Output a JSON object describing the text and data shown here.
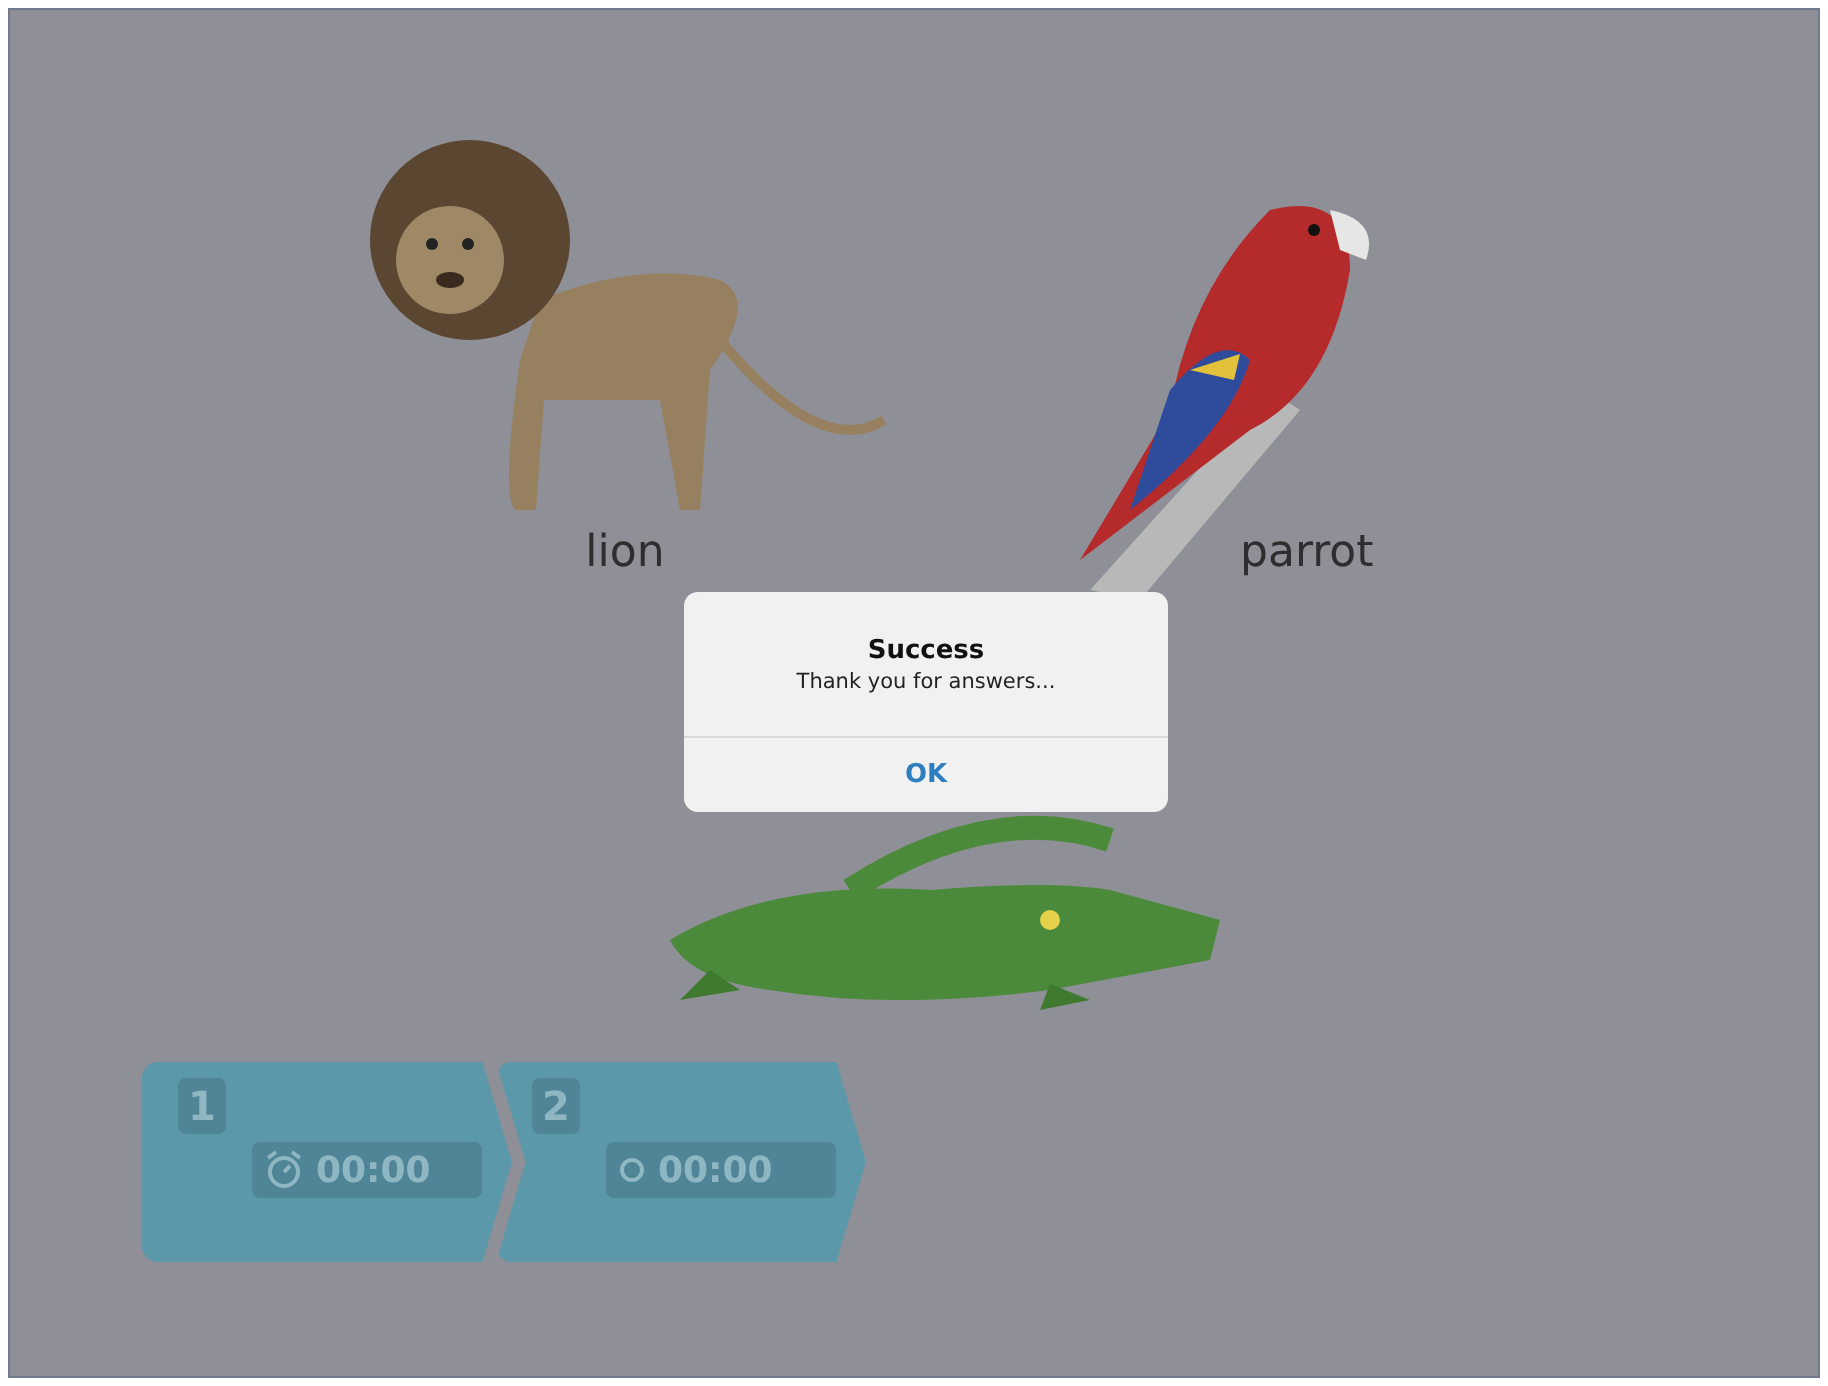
{
  "animals": [
    {
      "kind": "lion",
      "label": "lion"
    },
    {
      "kind": "parrot",
      "label": "parrot"
    },
    {
      "kind": "crocodile"
    }
  ],
  "steps": [
    {
      "number": "1",
      "timer": "00:00",
      "kind": "alarm"
    },
    {
      "number": "2",
      "timer": "00:00",
      "kind": "stopwatch"
    }
  ],
  "dialog": {
    "title": "Success",
    "message": "Thank you for answers...",
    "button": "OK"
  }
}
